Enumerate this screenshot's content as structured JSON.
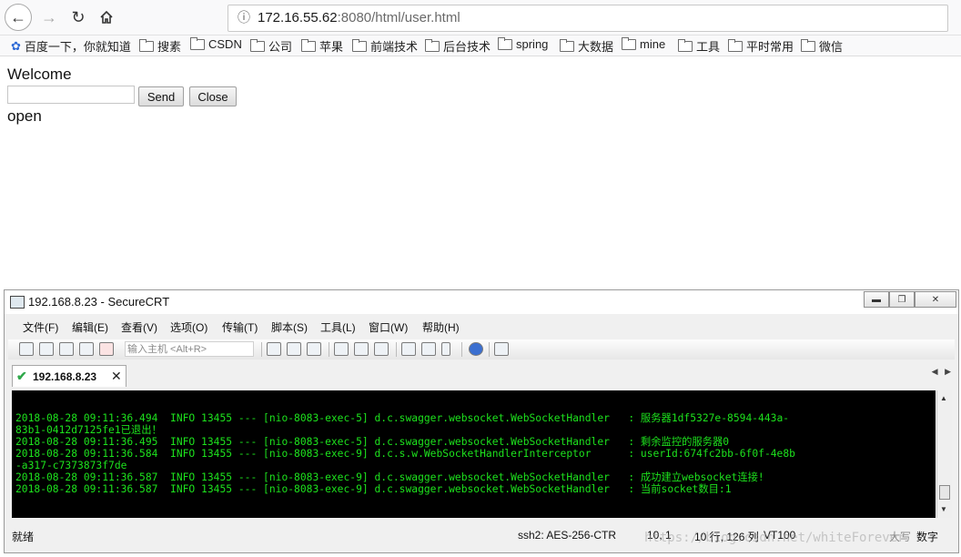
{
  "browser": {
    "url_host": "172.16.55.62",
    "url_rest": ":8080/html/user.html",
    "bookmarks": [
      "百度一下，你就知道",
      "搜素",
      "CSDN",
      "公司",
      "苹果",
      "前端技术",
      "后台技术",
      "spring",
      "大数据",
      "mine",
      "工具",
      "平时常用",
      "微信"
    ]
  },
  "page": {
    "welcome": "Welcome",
    "send_label": "Send",
    "close_label": "Close",
    "status_text": "open"
  },
  "crt": {
    "window_title": "192.168.8.23 - SecureCRT",
    "menu": [
      "文件(F)",
      "编辑(E)",
      "查看(V)",
      "选项(O)",
      "传输(T)",
      "脚本(S)",
      "工具(L)",
      "窗口(W)",
      "帮助(H)"
    ],
    "host_placeholder": "输入主机 <Alt+R>",
    "tab_label": "192.168.8.23",
    "terminal_lines": [
      "2018-08-28 09:11:36.494  INFO 13455 --- [nio-8083-exec-5] d.c.swagger.websocket.WebSocketHandler   : 服务器1df5327e-8594-443a-",
      "83b1-0412d7125fe1已退出！",
      "2018-08-28 09:11:36.495  INFO 13455 --- [nio-8083-exec-5] d.c.swagger.websocket.WebSocketHandler   : 剩余监控的服务器0",
      "2018-08-28 09:11:36.584  INFO 13455 --- [nio-8083-exec-9] d.c.s.w.WebSocketHandlerInterceptor      : userId:674fc2bb-6f0f-4e8b",
      "-a317-c7373873f7de",
      "2018-08-28 09:11:36.587  INFO 13455 --- [nio-8083-exec-9] d.c.swagger.websocket.WebSocketHandler   : 成功建立websocket连接!",
      "2018-08-28 09:11:36.587  INFO 13455 --- [nio-8083-exec-9] d.c.swagger.websocket.WebSocketHandler   : 当前socket数目:1"
    ],
    "status": {
      "ready": "就绪",
      "cipher": "ssh2: AES-256-CTR",
      "cursor": "10,  1",
      "size": "10 行, 126 列",
      "term": "VT100",
      "caps": "大写",
      "num": "数字"
    }
  },
  "watermark": "https://blog.csdn.net/whiteForever"
}
